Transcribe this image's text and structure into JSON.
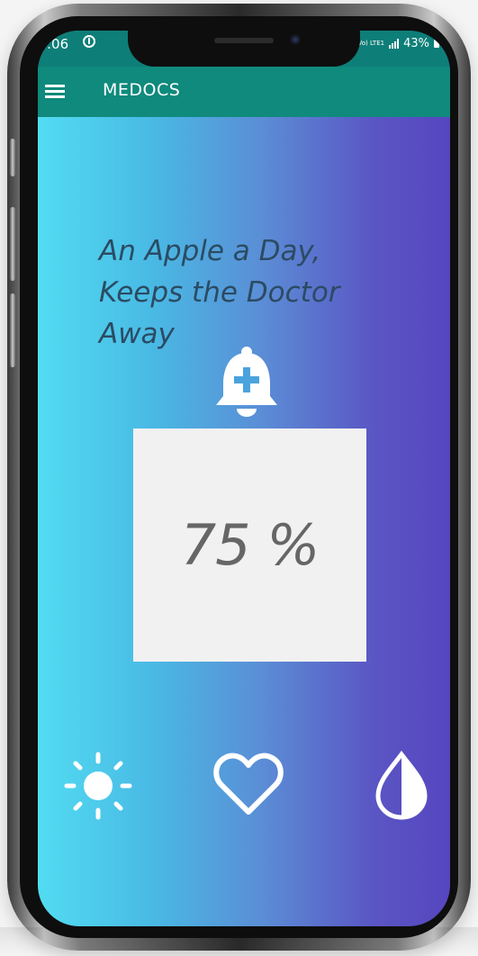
{
  "status_bar": {
    "time": ":06",
    "network_label": "Vo) LTE1",
    "battery": "43%"
  },
  "app_bar": {
    "title": "MEDOCS",
    "menu_icon": "menu-icon"
  },
  "main": {
    "quote": "An Apple a Day,\nKeeps the Doctor\nAway",
    "bell_icon": "bell-plus-icon",
    "stat_value": "75 %"
  },
  "bottom_actions": [
    {
      "icon": "sun-icon"
    },
    {
      "icon": "heart-icon"
    },
    {
      "icon": "contrast-drop-icon"
    }
  ],
  "colors": {
    "status_bar": "#0e7e78",
    "app_bar": "#0f8a7c",
    "gradient_start": "#52dcf2",
    "gradient_end": "#5646bf",
    "quote_text": "#2b4b63",
    "stat_text": "#666666",
    "card_background": "#f1f1f1"
  }
}
